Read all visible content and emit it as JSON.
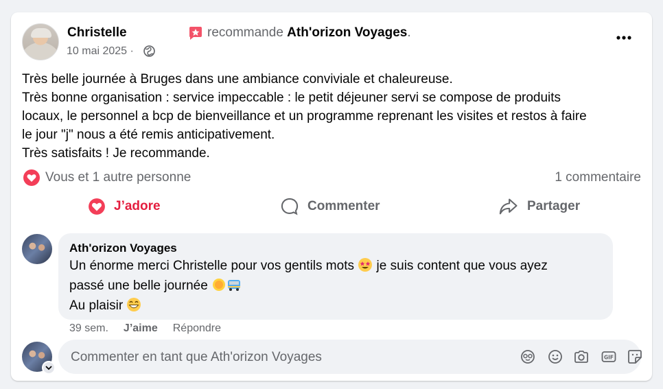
{
  "post": {
    "author": "Christelle",
    "date": "10 mai 2025 ·",
    "rec_prefix": "recommande ",
    "rec_page": "Ath'orizon Voyages",
    "rec_suffix": ".",
    "lines": [
      "Très belle journée à Bruges dans une ambiance conviviale et chaleureuse.",
      "Très bonne organisation : service impeccable : le  petit déjeuner servi se compose de produits",
      "locaux, le personnel  a bcp de bienveillance et un programme reprenant les visites et restos à faire",
      "le jour \"j\" nous a été remis anticipativement.",
      "Très satisfaits ! Je recommande."
    ]
  },
  "reactions": {
    "label": "Vous et 1 autre personne",
    "comments": "1 commentaire"
  },
  "actions": {
    "like": "J’adore",
    "comment": "Commenter",
    "share": "Partager"
  },
  "comment": {
    "author": "Ath'orizon Voyages",
    "text1": "Un énorme merci Christelle pour vos gentils mots",
    "text1b": " je suis content que vous ayez",
    "text2": "passé une belle journée ",
    "text3": "Au plaisir ",
    "time": "39 sem.",
    "like": "J’aime",
    "reply": "Répondre"
  },
  "composer": {
    "placeholder": "Commenter en tant que Ath'orizon Voyages"
  },
  "colors": {
    "accent_red": "#e41e3f",
    "muted": "#65676b",
    "bubble": "#f0f2f5"
  },
  "icons": [
    "globe-icon",
    "recommend-icon",
    "more-icon",
    "heart-icon",
    "comment-icon",
    "share-icon",
    "avatar-icon",
    "emoji-icon",
    "camera-icon",
    "gif-icon",
    "sticker-icon"
  ]
}
